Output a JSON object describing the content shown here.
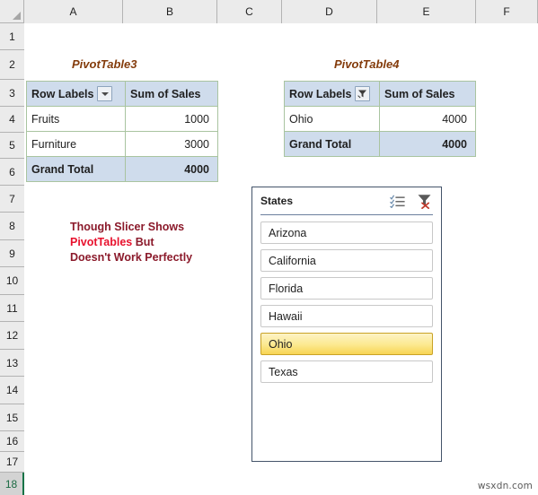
{
  "spreadsheet": {
    "columns": [
      "A",
      "B",
      "C",
      "D",
      "E",
      "F"
    ],
    "rows": [
      "1",
      "2",
      "3",
      "4",
      "5",
      "6",
      "7",
      "8",
      "9",
      "10",
      "11",
      "12",
      "13",
      "14",
      "15",
      "16",
      "17",
      "18"
    ],
    "active_row": "18",
    "select_all_icon": "select-all-triangle-icon"
  },
  "pivot_table_3": {
    "title": "PivotTable3",
    "headers": {
      "row_labels": "Row Labels",
      "value": "Sum of Sales",
      "filter_icon": "dropdown-arrow-icon"
    },
    "rows": [
      {
        "label": "Fruits",
        "value": "1000"
      },
      {
        "label": "Furniture",
        "value": "3000"
      }
    ],
    "grand_total": {
      "label": "Grand Total",
      "value": "4000"
    }
  },
  "pivot_table_4": {
    "title": "PivotTable4",
    "headers": {
      "row_labels": "Row Labels",
      "value": "Sum of Sales",
      "filter_icon": "funnel-filter-applied-icon"
    },
    "rows": [
      {
        "label": "Ohio",
        "value": "4000"
      }
    ],
    "grand_total": {
      "label": "Grand Total",
      "value": "4000"
    }
  },
  "annotation": {
    "line1": "Though Slicer Shows",
    "line2_highlight": "PivotTables",
    "line2_rest": " But",
    "line3": "Doesn't Work Perfectly",
    "color": "#8b1a2b",
    "highlight_color": "#e8112d"
  },
  "slicer": {
    "title": "States",
    "multi_select_icon": "multi-select-icon",
    "clear_filter_icon": "clear-filter-icon",
    "items": [
      {
        "label": "Arizona",
        "selected": false
      },
      {
        "label": "California",
        "selected": false
      },
      {
        "label": "Florida",
        "selected": false
      },
      {
        "label": "Hawaii",
        "selected": false
      },
      {
        "label": "Ohio",
        "selected": true
      },
      {
        "label": "Texas",
        "selected": false
      }
    ],
    "border_color": "#44546a",
    "selected_color": "#fce98f"
  },
  "watermark": "wsxdn.com"
}
